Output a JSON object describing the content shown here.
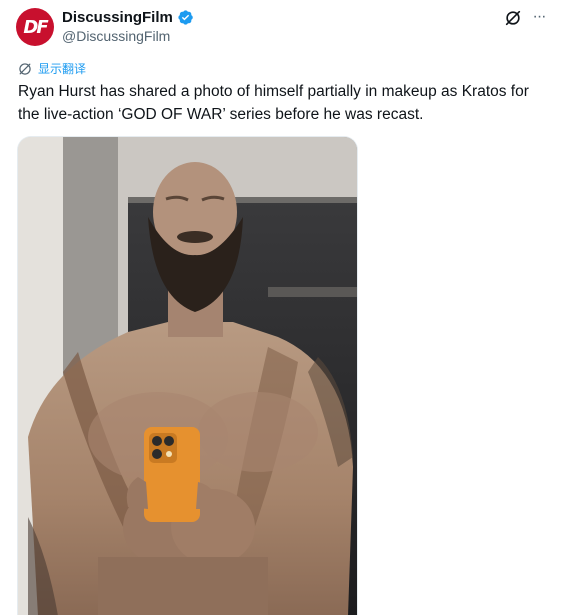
{
  "author": {
    "display_name": "DiscussingFilm",
    "handle": "@DiscussingFilm",
    "avatar_text": "DF",
    "verified": true
  },
  "actions": {
    "grok_icon": "grok-icon",
    "more_icon": "more-icon",
    "more_glyph": "···"
  },
  "translate": {
    "label": "显示翻译",
    "icon": "translate-icon"
  },
  "tweet": {
    "text": "Ryan Hurst has shared a photo of himself partially in makeup as Kratos for the live-action ‘GOD OF WAR’ series before he was recast."
  },
  "media": {
    "type": "photo",
    "subject": "mirror-selfie"
  },
  "colors": {
    "brand_red": "#c8102e",
    "verified_blue": "#1d9bf0",
    "link_blue": "#1d9bf0",
    "secondary_text": "#536471",
    "phone_orange": "#e6912f"
  }
}
